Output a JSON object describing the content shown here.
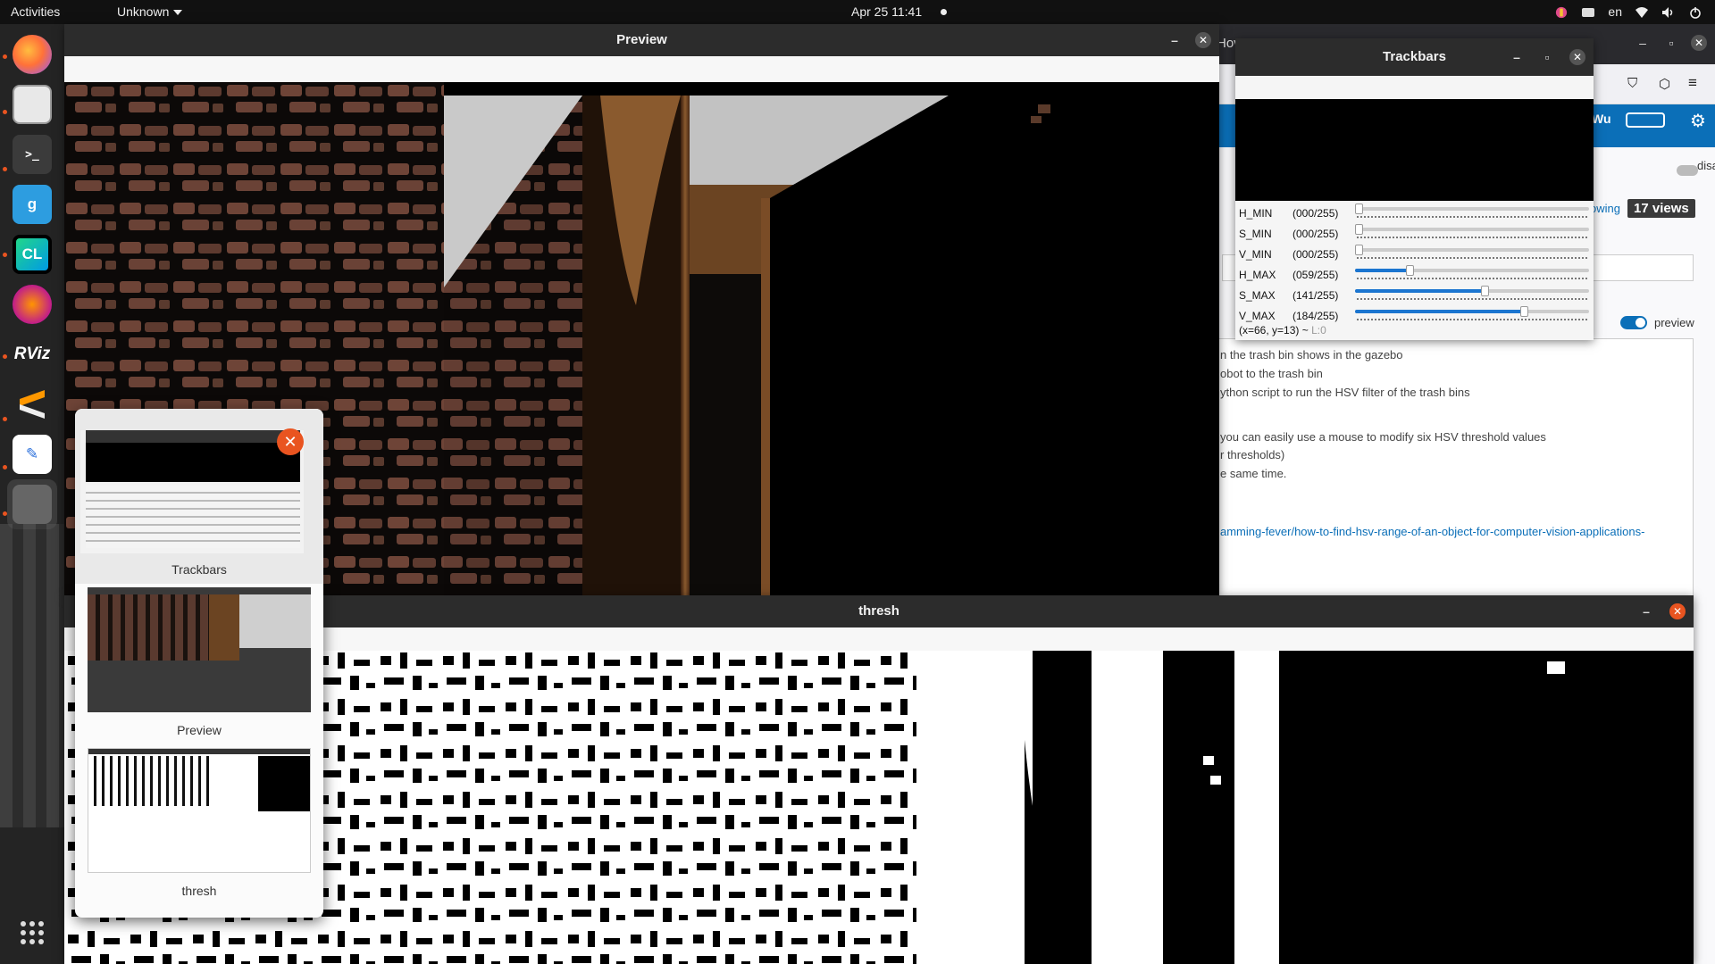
{
  "topbar": {
    "activities": "Activities",
    "app_menu": "Unknown",
    "clock": "Apr 25  11:41",
    "lang": "en"
  },
  "dock": {
    "apps": [
      "firefox-icon",
      "files-icon",
      "terminal-icon",
      "gnome-software-icon",
      "clion-icon",
      "gnome-icon",
      "rviz-icon",
      "sublime-icon",
      "text-editor-icon",
      "window-icon",
      "grid-icon"
    ],
    "labels": {
      "clion": "CL",
      "rviz": "RViz"
    }
  },
  "browser": {
    "tab_fragment": "Hov",
    "user_fragment": "Wu",
    "disable_history": "disable history",
    "following_fragment": "owing",
    "views": "17 views",
    "preview_label": "preview",
    "editor_lines": [
      "n the trash bin shows in the gazebo",
      "obot to the trash bin",
      "ython script to run the HSV filter of the trash bins",
      "",
      " you can easily use a mouse to modify six HSV threshold values",
      "r thresholds)",
      "e same time.",
      "",
      "amming-fever/how-to-find-hsv-range-of-an-object-for-computer-vision-applications-"
    ],
    "accent": "#0b6fb8"
  },
  "trackbars": {
    "title": "Trackbars",
    "rows": [
      {
        "name": "H_MIN",
        "value": "(000/255)",
        "level": 0
      },
      {
        "name": "S_MIN",
        "value": "(000/255)",
        "level": 0
      },
      {
        "name": "V_MIN",
        "value": "(000/255)",
        "level": 0
      },
      {
        "name": "H_MAX",
        "value": "(059/255)",
        "level": 0.231
      },
      {
        "name": "S_MAX",
        "value": "(141/255)",
        "level": 0.553
      },
      {
        "name": "V_MAX",
        "value": "(184/255)",
        "level": 0.722
      }
    ],
    "status": "(x=66, y=13) ~",
    "status_dim": "L:0"
  },
  "preview": {
    "title": "Preview"
  },
  "thresh": {
    "title": "thresh"
  },
  "switcher": {
    "items": [
      {
        "label": "Trackbars"
      },
      {
        "label": "Preview"
      },
      {
        "label": "thresh"
      }
    ]
  },
  "colors": {
    "ubuntu_orange": "#e95420",
    "slider_blue": "#1b75d0"
  }
}
